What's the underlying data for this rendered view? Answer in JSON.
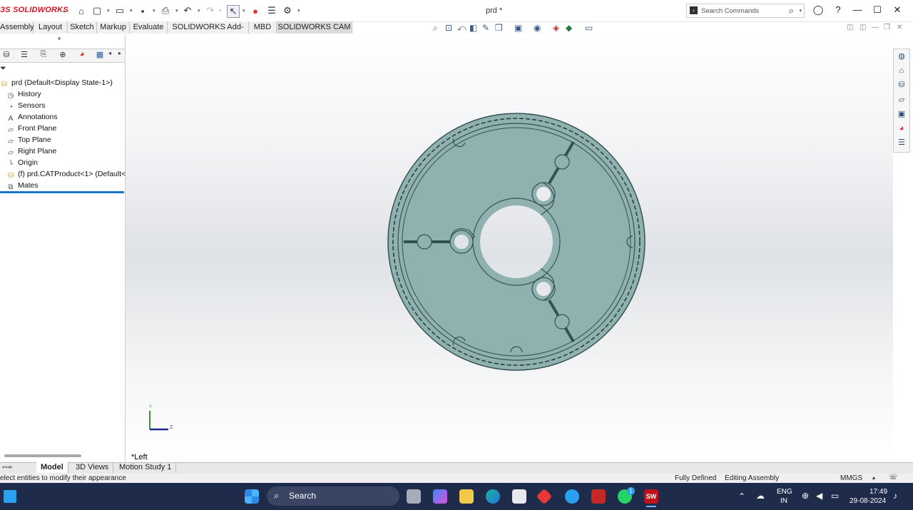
{
  "app": {
    "logo": "SOLIDWORKS",
    "document_title": "prd *"
  },
  "search": {
    "placeholder": "Search Commands"
  },
  "window_buttons": [
    "—",
    "☐",
    "✕"
  ],
  "ribbon_tabs": [
    "Assembly",
    "Layout",
    "Sketch",
    "Markup",
    "Evaluate",
    "SOLIDWORKS Add-Ins",
    "MBD",
    "SOLIDWORKS CAM"
  ],
  "tree": {
    "root": "prd  (Default<Display State-1>)",
    "items": [
      "History",
      "Sensors",
      "Annotations",
      "Front Plane",
      "Top Plane",
      "Right Plane",
      "Origin",
      "(f) prd.CATProduct<1> (Default<",
      "Mates"
    ]
  },
  "viewport": {
    "view_label": "*Left",
    "triad_y": "Y",
    "triad_z": "Z"
  },
  "bottom_tabs": [
    "Model",
    "3D Views",
    "Motion Study 1"
  ],
  "status": {
    "message": "elect entities to modify their appearance",
    "state": "Fully Defined",
    "mode": "Editing Assembly",
    "units": "MMGS"
  },
  "taskbar": {
    "search_label": "Search",
    "language": "ENG",
    "region": "IN",
    "time": "17:49",
    "date": "29-08-2024",
    "whatsapp_badge": "1"
  },
  "colors": {
    "part": "#8fb1af",
    "accent_blue": "#1a77c9",
    "taskbar": "#1f2b4a"
  }
}
